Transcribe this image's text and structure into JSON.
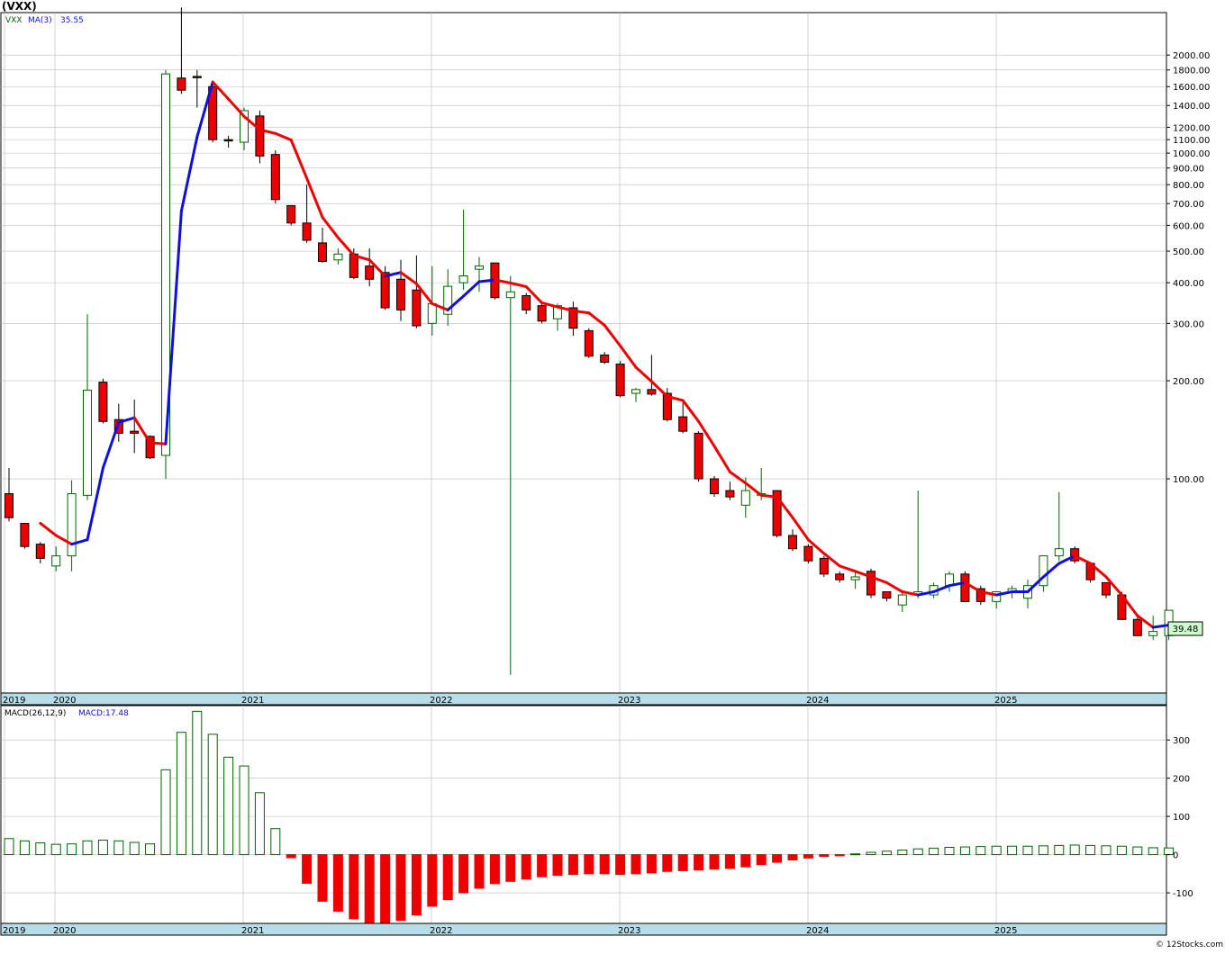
{
  "title": "(VXX)",
  "price_legend": {
    "symbol": "VXX",
    "ma_label": "MA(3)",
    "ma_value": "35.55"
  },
  "macd_legend": {
    "label": "MACD(26,12,9)",
    "value_label": "MACD:17.48"
  },
  "last_price_label": "39.48",
  "footer": "© 12Stocks.com",
  "colors": {
    "up": "#ffffff",
    "up_border": "#006400",
    "down": "#ee0000",
    "ma_down": "#ee0000",
    "ma_up": "#1010dd",
    "axis_bar": "#b6dde8",
    "grid": "#bbbbbb",
    "last_price_bg": "#ccffcc"
  },
  "chart_data": [
    {
      "type": "candlestick",
      "scale": "log",
      "ylim": [
        22,
        2700
      ],
      "y_ticks": [
        2000,
        1800,
        1600,
        1400,
        1200,
        1100,
        1000,
        900,
        800,
        700,
        600,
        500,
        400,
        300,
        200,
        100
      ],
      "x_ticks": [
        "2019",
        "2020",
        "2021",
        "2022",
        "2023",
        "2024",
        "2025"
      ],
      "ohlc": [
        [
          90,
          108,
          74,
          76
        ],
        [
          73,
          73,
          61,
          62
        ],
        [
          63,
          64,
          55,
          57
        ],
        [
          54,
          62,
          52,
          58
        ],
        [
          58,
          99,
          52,
          90
        ],
        [
          89,
          320,
          86,
          187
        ],
        [
          198,
          203,
          148,
          150
        ],
        [
          152,
          170,
          130,
          138
        ],
        [
          140,
          175,
          120,
          138
        ],
        [
          135,
          136,
          115,
          116
        ],
        [
          118,
          1800,
          100,
          1750
        ],
        [
          1700,
          2800,
          1520,
          1560
        ],
        [
          1720,
          1800,
          1380,
          1710
        ],
        [
          1600,
          1650,
          1080,
          1100
        ],
        [
          1100,
          1130,
          1040,
          1090
        ],
        [
          1080,
          1380,
          1020,
          1350
        ],
        [
          1300,
          1350,
          930,
          980
        ],
        [
          990,
          1020,
          700,
          720
        ],
        [
          690,
          690,
          600,
          610
        ],
        [
          610,
          800,
          530,
          540
        ],
        [
          530,
          590,
          460,
          465
        ],
        [
          470,
          510,
          455,
          490
        ],
        [
          490,
          510,
          410,
          415
        ],
        [
          450,
          510,
          390,
          410
        ],
        [
          430,
          450,
          330,
          335
        ],
        [
          410,
          470,
          305,
          330
        ],
        [
          380,
          485,
          290,
          295
        ],
        [
          300,
          450,
          275,
          345
        ],
        [
          320,
          440,
          295,
          390
        ],
        [
          400,
          670,
          380,
          420
        ],
        [
          440,
          480,
          375,
          450
        ],
        [
          460,
          460,
          355,
          360
        ],
        [
          360,
          420,
          25,
          375
        ],
        [
          365,
          372,
          320,
          330
        ],
        [
          340,
          345,
          300,
          305
        ],
        [
          310,
          345,
          285,
          340
        ],
        [
          335,
          350,
          275,
          290
        ],
        [
          285,
          290,
          235,
          238
        ],
        [
          240,
          245,
          225,
          228
        ],
        [
          225,
          230,
          178,
          180
        ],
        [
          183,
          190,
          172,
          188
        ],
        [
          188,
          240,
          180,
          182
        ],
        [
          183,
          190,
          150,
          152
        ],
        [
          155,
          172,
          138,
          140
        ],
        [
          138,
          140,
          98,
          100
        ],
        [
          100,
          102,
          88,
          90
        ],
        [
          92,
          98,
          86,
          88
        ],
        [
          83,
          101,
          76,
          92
        ],
        [
          89,
          108,
          86,
          90
        ],
        [
          92,
          92,
          66,
          67
        ],
        [
          67,
          70,
          60,
          61
        ],
        [
          62,
          63,
          55,
          56
        ],
        [
          57,
          58,
          50,
          51
        ],
        [
          51,
          52,
          48,
          49
        ],
        [
          49,
          52,
          46,
          50
        ],
        [
          52,
          53,
          43,
          44
        ],
        [
          45,
          45,
          42,
          43
        ],
        [
          41,
          45,
          39,
          44
        ],
        [
          44,
          92,
          43,
          45
        ],
        [
          44,
          48,
          43,
          47
        ],
        [
          47,
          52,
          45,
          51
        ],
        [
          51,
          52,
          42,
          42
        ],
        [
          46,
          47,
          41,
          42
        ],
        [
          42,
          45,
          40,
          45
        ],
        [
          45,
          47,
          43,
          46
        ],
        [
          43,
          49,
          40,
          47
        ],
        [
          47,
          53,
          45,
          58
        ],
        [
          58,
          91,
          56,
          61
        ],
        [
          61,
          62,
          55,
          56
        ],
        [
          55,
          55,
          48,
          49
        ],
        [
          48,
          48,
          43,
          44
        ],
        [
          44,
          45,
          37,
          37
        ],
        [
          37,
          38,
          33,
          33
        ],
        [
          33,
          38,
          32,
          34
        ],
        [
          33,
          38,
          32,
          39.48
        ]
      ],
      "ma3": [
        null,
        null,
        73,
        67,
        63,
        65,
        108,
        149,
        154,
        129,
        128,
        664,
        1121,
        1653,
        1466,
        1296,
        1180,
        1149,
        1097,
        837,
        635,
        550,
        485,
        470,
        419,
        430,
        397,
        345,
        330,
        364,
        403,
        408,
        399,
        389,
        347,
        337,
        328,
        323,
        296,
        256,
        220,
        199,
        179,
        174,
        150,
        126,
        105,
        97,
        89,
        88,
        76,
        65,
        59,
        54,
        52,
        50,
        48,
        45,
        44,
        45,
        47,
        48,
        45,
        44,
        45,
        45,
        50,
        55,
        58,
        55,
        50,
        44,
        38,
        35,
        35.55
      ]
    },
    {
      "type": "bar",
      "title": "MACD(26,12,9)",
      "ylim": [
        -180,
        390
      ],
      "y_ticks": [
        300,
        200,
        100,
        0,
        -100
      ],
      "x_ticks": [
        "2019",
        "2020",
        "2021",
        "2022",
        "2023",
        "2024",
        "2025"
      ],
      "values": [
        42,
        36,
        31,
        27,
        28,
        36,
        38,
        36,
        32,
        28,
        222,
        320,
        375,
        315,
        255,
        232,
        162,
        68,
        -8,
        -75,
        -122,
        -148,
        -168,
        -178,
        -182,
        -172,
        -158,
        -135,
        -118,
        -100,
        -88,
        -76,
        -70,
        -64,
        -58,
        -54,
        -52,
        -50,
        -50,
        -52,
        -50,
        -48,
        -44,
        -42,
        -40,
        -38,
        -36,
        -32,
        -26,
        -20,
        -14,
        -9,
        -5,
        -3,
        2,
        6,
        9,
        12,
        15,
        17,
        19,
        20,
        21,
        22,
        22,
        22,
        23,
        24,
        25,
        24,
        23,
        22,
        20,
        18,
        17.48
      ]
    }
  ]
}
